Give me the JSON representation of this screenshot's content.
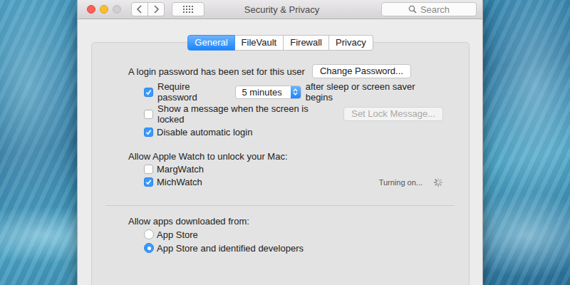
{
  "window": {
    "title": "Security & Privacy"
  },
  "search": {
    "placeholder": "Search"
  },
  "tabs": [
    {
      "label": "General",
      "selected": true
    },
    {
      "label": "FileVault",
      "selected": false
    },
    {
      "label": "Firewall",
      "selected": false
    },
    {
      "label": "Privacy",
      "selected": false
    }
  ],
  "login_password": {
    "label": "A login password has been set for this user",
    "button": "Change Password..."
  },
  "options": [
    {
      "kind": "select",
      "label": "Require password",
      "checked": true,
      "value": "5 minutes",
      "suffix": "after sleep or screen saver begins"
    },
    {
      "kind": "button",
      "label": "Show a message when the screen is locked",
      "checked": false,
      "button": "Set Lock Message...",
      "button_disabled": true
    },
    {
      "kind": "plain",
      "label": "Disable automatic login",
      "checked": true
    }
  ],
  "apple_watch": {
    "heading": "Allow Apple Watch to unlock your Mac:",
    "watches": [
      {
        "name": "MargWatch",
        "checked": false,
        "status": "",
        "busy": false
      },
      {
        "name": "MichWatch",
        "checked": true,
        "status": "Turning on...",
        "busy": true
      }
    ]
  },
  "downloads": {
    "heading": "Allow apps downloaded from:",
    "options": [
      {
        "label": "App Store",
        "selected": false
      },
      {
        "label": "App Store and identified developers",
        "selected": true
      }
    ]
  }
}
